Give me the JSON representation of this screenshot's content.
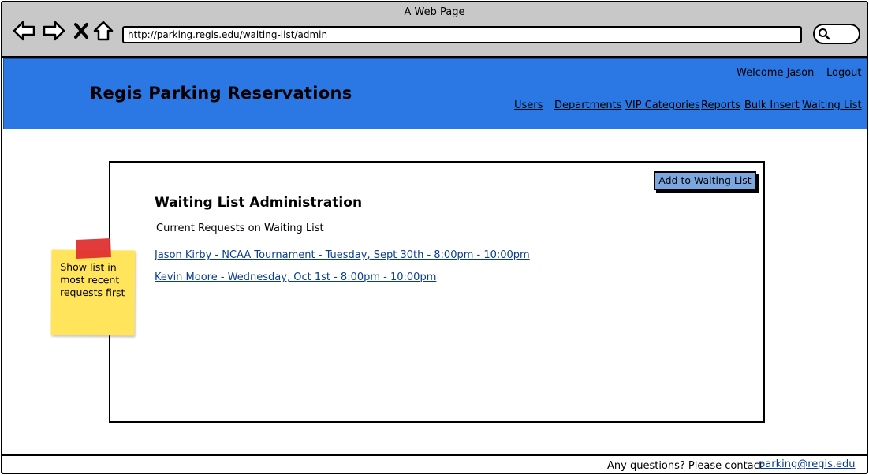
{
  "window": {
    "title": "A Web Page",
    "url": "http://parking.regis.edu/waiting-list/admin"
  },
  "header": {
    "brand": "Regis Parking Reservations",
    "welcome": "Welcome Jason",
    "logout": "Logout",
    "nav": [
      "Users",
      "Departments",
      "VIP Categories",
      "Reports",
      "Bulk Insert",
      "Waiting List"
    ],
    "accent_color": "#2b78e4"
  },
  "main": {
    "add_button": "Add to Waiting List",
    "title": "Waiting List Administration",
    "subtitle": "Current Requests on Waiting List",
    "requests": [
      "Jason Kirby - NCAA Tournament - Tuesday, Sept 30th - 8:00pm - 10:00pm",
      "Kevin Moore - Wednesday, Oct 1st - 8:00pm - 10:00pm"
    ]
  },
  "note": {
    "text": "Show list in most recent requests first"
  },
  "footer": {
    "text": "Any questions? Please contact",
    "email": "parking@regis.edu"
  }
}
